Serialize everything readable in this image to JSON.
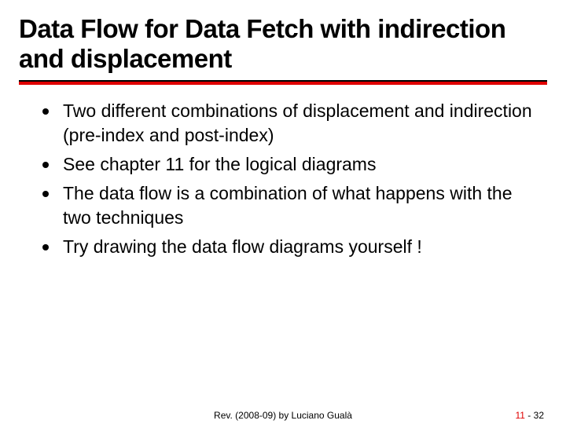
{
  "title": "Data Flow for Data Fetch with indirection and displacement",
  "bullets": [
    "Two different combinations of displacement and indirection (pre-index and post-index)",
    "See chapter 11 for the logical diagrams",
    "The data flow is a combination of what happens with the two techniques",
    "Try drawing the data flow diagrams yourself !"
  ],
  "footer": {
    "center": "Rev. (2008-09) by Luciano Gualà",
    "section": "11",
    "sep": " - ",
    "page": "32"
  }
}
